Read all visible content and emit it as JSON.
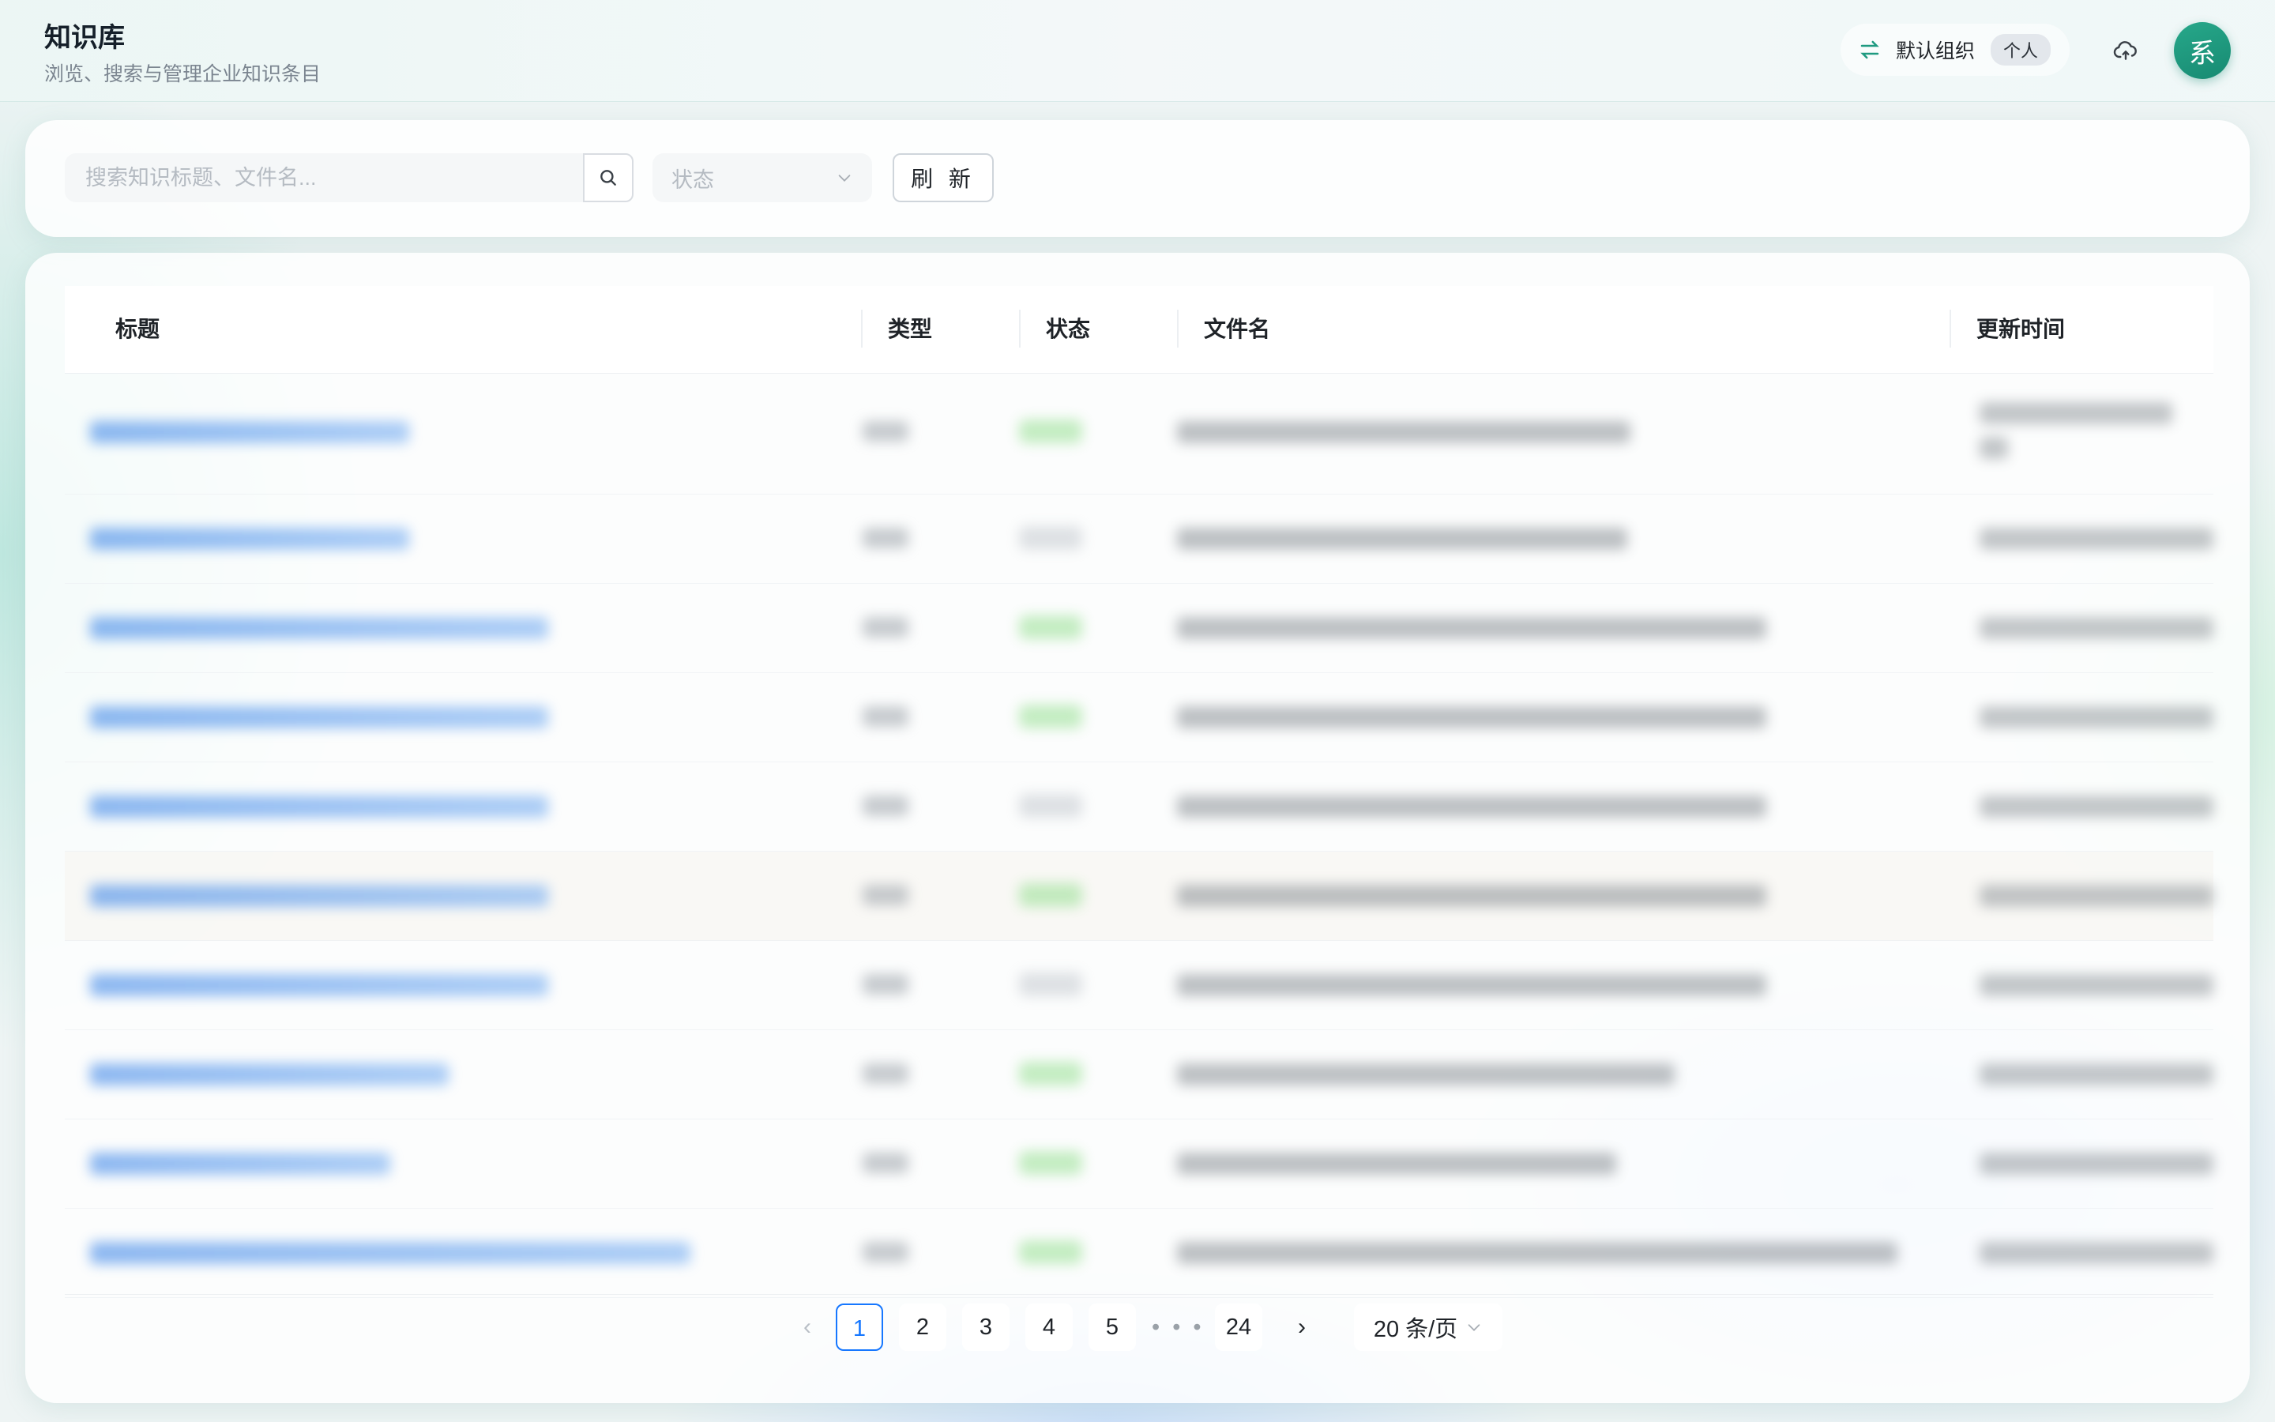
{
  "header": {
    "title": "知识库",
    "subtitle": "浏览、搜索与管理企业知识条目",
    "org_name": "默认组织",
    "org_badge": "个人",
    "avatar_text": "系",
    "icons": {
      "swap": "swap-icon",
      "cloud": "cloud-upload-icon"
    },
    "accent": "#1f9a80"
  },
  "toolbar": {
    "search_placeholder": "搜索知识标题、文件名...",
    "status_placeholder": "状态",
    "refresh_label": "刷 新"
  },
  "table": {
    "columns": [
      "标题",
      "类型",
      "状态",
      "文件名",
      "更新时间"
    ],
    "rows_blurred": true,
    "row_status": [
      "done",
      "proc",
      "done",
      "done",
      "proc",
      "done",
      "proc",
      "done",
      "done",
      "done"
    ]
  },
  "pagination": {
    "pages": [
      "1",
      "2",
      "3",
      "4",
      "5"
    ],
    "ellipsis": "• • •",
    "last_page": "24",
    "current": "1",
    "prev_symbol": "‹",
    "next_symbol": "›",
    "page_size": "20 条/页",
    "active_color": "#1677ff"
  }
}
